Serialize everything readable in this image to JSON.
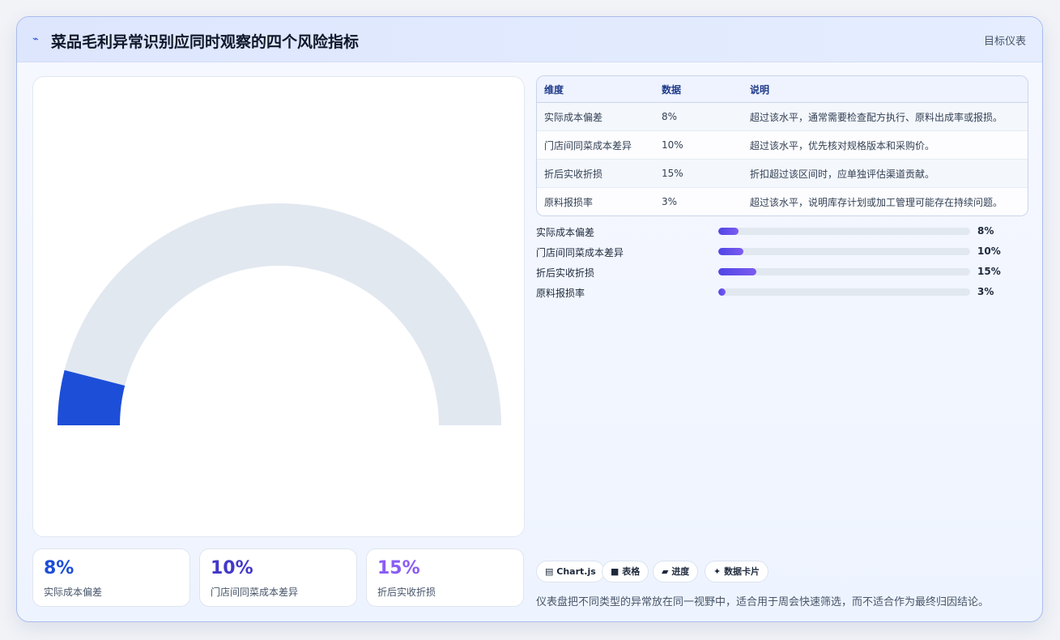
{
  "header": {
    "icon": "trend-icon",
    "title": "菜品毛利异常识别应同时观察的四个风险指标",
    "badge": "目标仪表"
  },
  "table": {
    "headers": [
      "维度",
      "数据",
      "说明"
    ],
    "rows": [
      [
        "实际成本偏差",
        "8%",
        "超过该水平，通常需要检查配方执行、原料出成率或报损。"
      ],
      [
        "门店间同菜成本差异",
        "10%",
        "超过该水平，优先核对规格版本和采购价。"
      ],
      [
        "折后实收折损",
        "15%",
        "折扣超过该区间时，应单独评估渠道贡献。"
      ],
      [
        "原料报损率",
        "3%",
        "超过该水平，说明库存计划或加工管理可能存在持续问题。"
      ]
    ]
  },
  "chart_data": [
    {
      "type": "gauge",
      "value": 8,
      "range": [
        0,
        100
      ],
      "colors": {
        "fill": "#1d4ed8",
        "track": "#e2e8f0"
      }
    },
    {
      "type": "bar",
      "orientation": "horizontal",
      "categories": [
        "实际成本偏差",
        "门店间同菜成本差异",
        "折后实收折损",
        "原料报损率"
      ],
      "values": [
        8,
        10,
        15,
        3
      ],
      "value_labels": [
        "8%",
        "10%",
        "15%",
        "3%"
      ],
      "range": [
        0,
        100
      ]
    }
  ],
  "stats": [
    {
      "value": "8%",
      "label": "实际成本偏差",
      "color": "#1d4ed8"
    },
    {
      "value": "10%",
      "label": "门店间同菜成本差异",
      "color": "#4338ca"
    },
    {
      "value": "15%",
      "label": "折后实收折损",
      "color": "#8b5cf6"
    }
  ],
  "chips": [
    {
      "icon": "▤",
      "label": "Chart.js"
    },
    {
      "icon": "■",
      "label": "表格"
    },
    {
      "icon": "▰",
      "label": "进度"
    },
    {
      "icon": "✦",
      "label": "数据卡片"
    }
  ],
  "footnote": "仪表盘把不同类型的异常放在同一视野中，适合用于周会快速筛选，而不适合作为最终归因结论。"
}
